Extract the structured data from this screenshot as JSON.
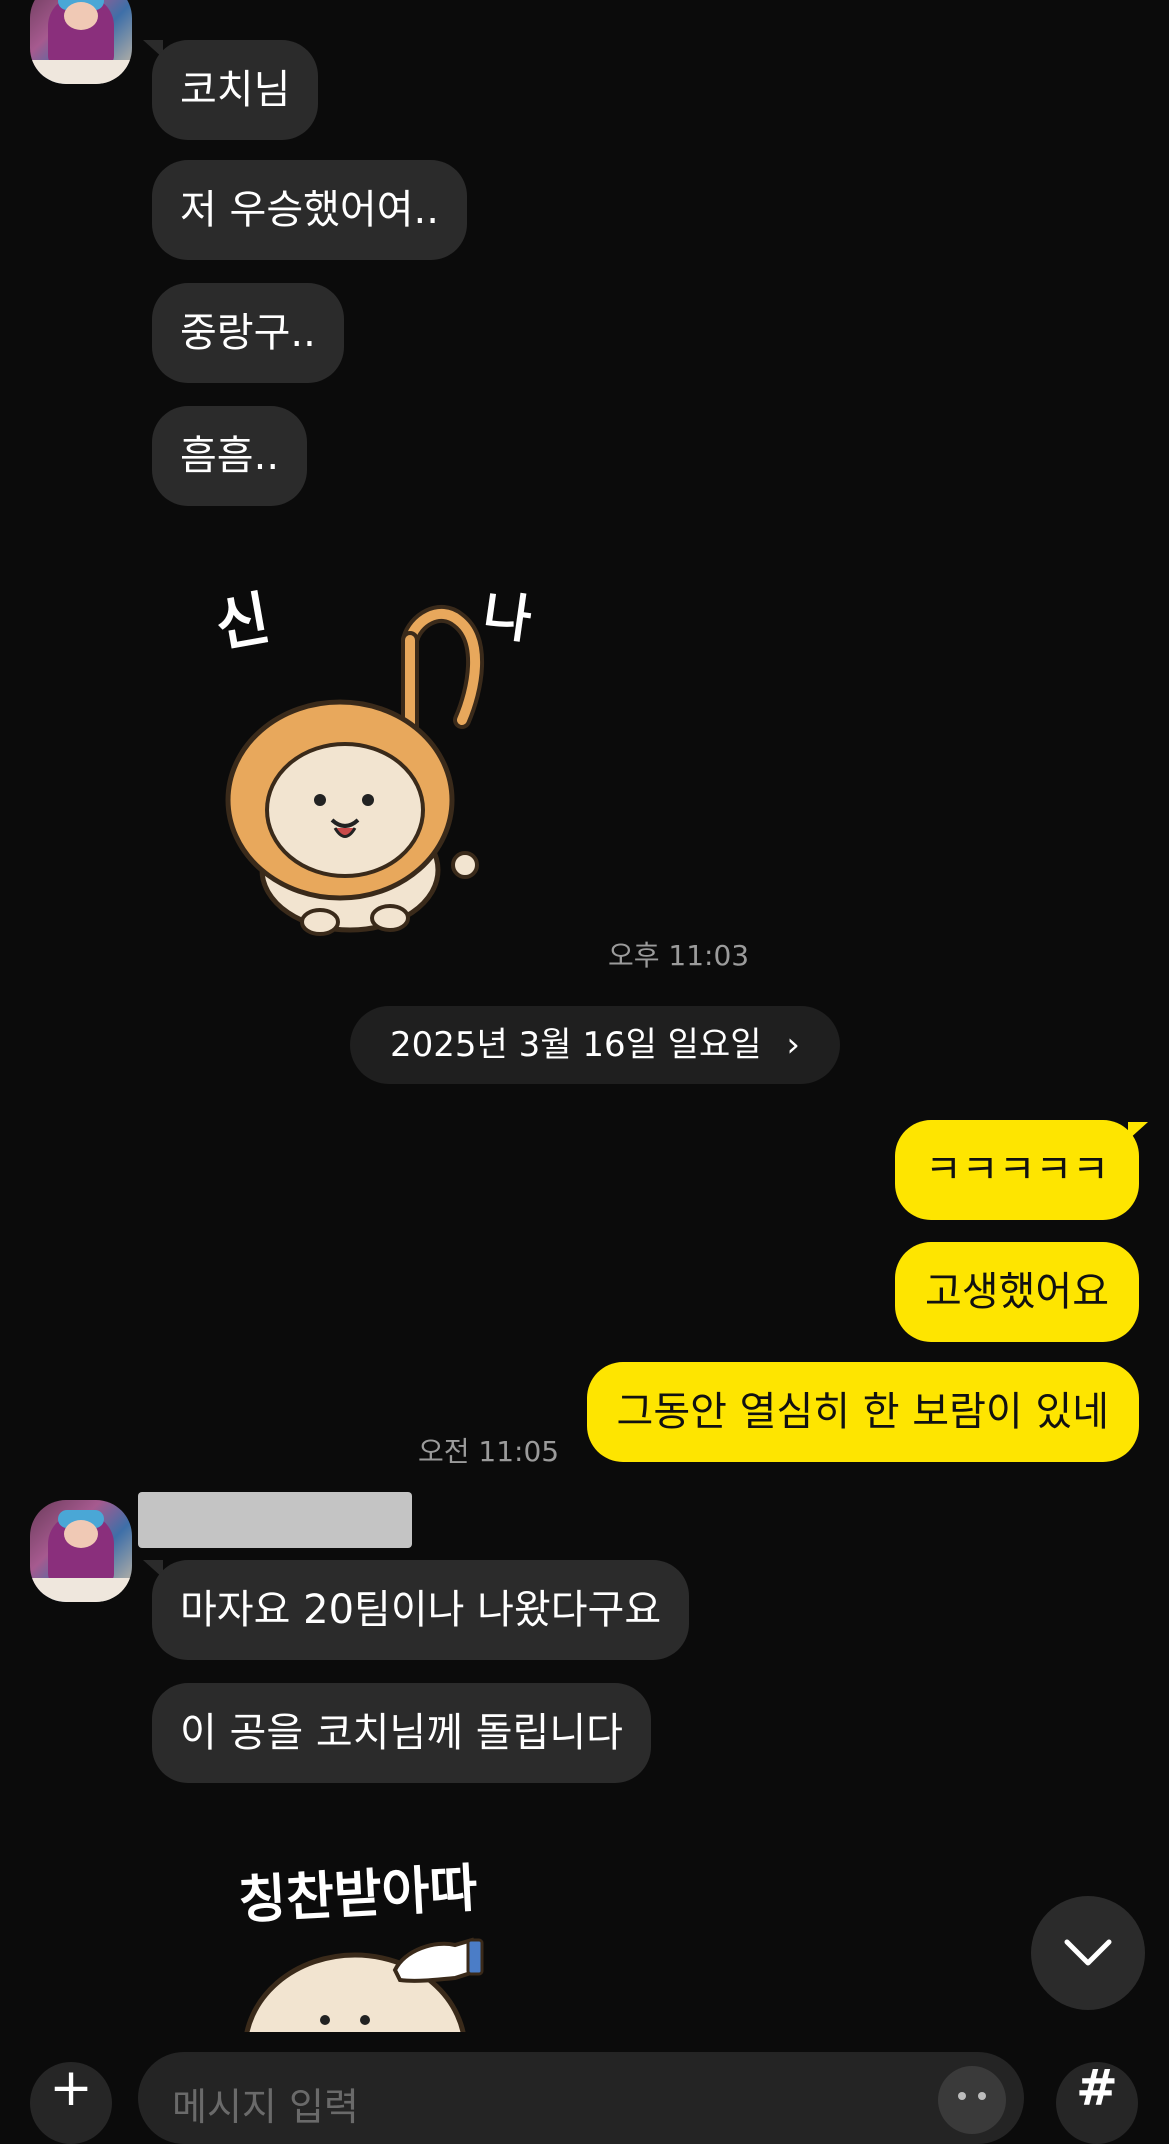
{
  "thread": {
    "incoming_1": {
      "messages": [
        "코치님",
        "저 우승했어여..",
        "중랑구..",
        "흠흠.."
      ],
      "sticker_text_left": "신",
      "sticker_text_right": "나",
      "time": "오후 11:03"
    },
    "date_divider": {
      "label": "2025년 3월 16일 일요일",
      "chevron": "›"
    },
    "outgoing": {
      "messages": [
        "ㅋㅋㅋㅋㅋ",
        "고생했어요",
        "그동안 열심히 한 보람이 있네"
      ],
      "time": "오전 11:05"
    },
    "incoming_2": {
      "messages": [
        "마자요 20팀이나 나왔다구요",
        "이 공을 코치님께 돌립니다"
      ],
      "sticker_text": "칭찬받아따"
    }
  },
  "composer": {
    "placeholder": "메시지 입력",
    "plus_icon": "+",
    "hash_icon": "#"
  },
  "colors": {
    "background": "#0b0b0b",
    "incoming_bubble": "#2b2b2b",
    "outgoing_bubble": "#fee500",
    "muted_text": "#9b9b9b"
  }
}
